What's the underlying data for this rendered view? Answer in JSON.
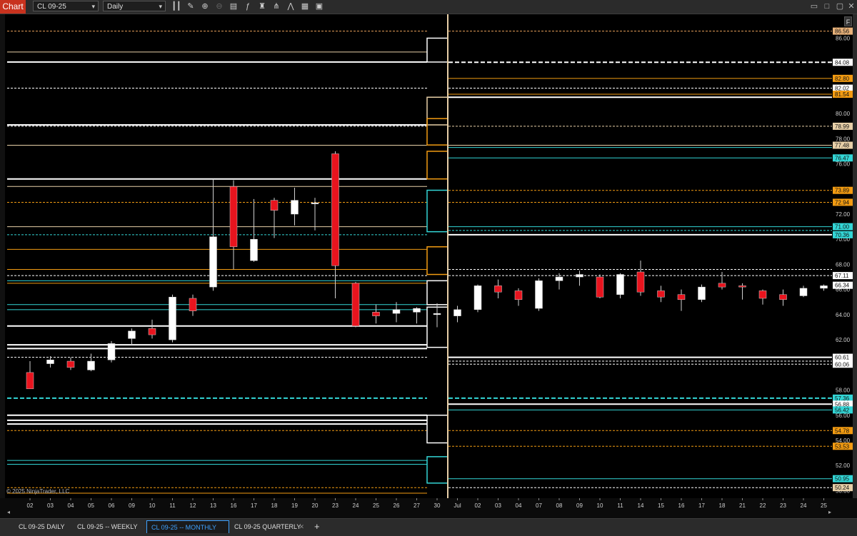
{
  "toolbar": {
    "title": "Chart",
    "instrument": "CL 09-25",
    "interval": "Daily",
    "icons": [
      "bar-type-icon",
      "draw-pencil-icon",
      "zoom-in-icon",
      "zoom-out-icon",
      "properties-icon",
      "indicators-icon",
      "strategies-icon",
      "drawing-tools-icon",
      "global-crosshair-icon",
      "data-box-icon"
    ]
  },
  "chart_data": {
    "type": "candlestick",
    "instrument": "CL 09-25",
    "interval": "Daily",
    "x_tick_labels": [
      "02",
      "03",
      "04",
      "05",
      "06",
      "09",
      "10",
      "11",
      "12",
      "13",
      "16",
      "17",
      "18",
      "19",
      "20",
      "23",
      "24",
      "25",
      "26",
      "27",
      "30",
      "Jul",
      "02",
      "03",
      "04",
      "07",
      "08",
      "09",
      "10",
      "11",
      "14",
      "15",
      "16",
      "17",
      "18",
      "21",
      "22",
      "23",
      "24",
      "25"
    ],
    "y_axis_ticks": [
      "86.00",
      "84.00",
      "82.00",
      "80.00",
      "78.00",
      "76.00",
      "74.00",
      "72.00",
      "70.00",
      "68.00",
      "66.00",
      "64.00",
      "62.00",
      "60.00",
      "58.00",
      "56.00",
      "54.00",
      "52.00",
      "50.00"
    ],
    "ylim": [
      49.4,
      87.9
    ],
    "candles": [
      {
        "x": "02",
        "o": 59.4,
        "h": 60.3,
        "l": 58.3,
        "c": 58.1
      },
      {
        "x": "03",
        "o": 60.1,
        "h": 60.7,
        "l": 59.8,
        "c": 60.4
      },
      {
        "x": "04",
        "o": 60.3,
        "h": 60.6,
        "l": 59.6,
        "c": 59.8
      },
      {
        "x": "05",
        "o": 59.6,
        "h": 60.9,
        "l": 59.5,
        "c": 60.3
      },
      {
        "x": "06",
        "o": 60.4,
        "h": 61.9,
        "l": 60.2,
        "c": 61.7
      },
      {
        "x": "09",
        "o": 62.1,
        "h": 62.9,
        "l": 61.6,
        "c": 62.7
      },
      {
        "x": "10",
        "o": 62.9,
        "h": 63.6,
        "l": 62.1,
        "c": 62.4
      },
      {
        "x": "11",
        "o": 62.0,
        "h": 65.6,
        "l": 61.8,
        "c": 65.4
      },
      {
        "x": "12",
        "o": 65.3,
        "h": 65.6,
        "l": 63.9,
        "c": 64.3
      },
      {
        "x": "13",
        "o": 66.2,
        "h": 74.8,
        "l": 65.9,
        "c": 70.2
      },
      {
        "x": "16",
        "o": 74.2,
        "h": 74.7,
        "l": 67.6,
        "c": 69.4
      },
      {
        "x": "17",
        "o": 68.3,
        "h": 73.2,
        "l": 68.2,
        "c": 70.0
      },
      {
        "x": "18",
        "o": 73.1,
        "h": 73.3,
        "l": 70.1,
        "c": 72.3
      },
      {
        "x": "19",
        "o": 72.0,
        "h": 74.1,
        "l": 71.1,
        "c": 73.1
      },
      {
        "x": "20",
        "o": 72.9,
        "h": 73.3,
        "l": 70.7,
        "c": 72.9
      },
      {
        "x": "23",
        "o": 76.8,
        "h": 77.0,
        "l": 65.3,
        "c": 67.9
      },
      {
        "x": "24",
        "o": 66.5,
        "h": 66.6,
        "l": 63.0,
        "c": 63.1
      },
      {
        "x": "25",
        "o": 64.2,
        "h": 64.8,
        "l": 63.3,
        "c": 63.9
      },
      {
        "x": "26",
        "o": 64.1,
        "h": 65.0,
        "l": 63.4,
        "c": 64.4
      },
      {
        "x": "27",
        "o": 64.2,
        "h": 64.6,
        "l": 63.3,
        "c": 64.5
      },
      {
        "x": "30",
        "o": 64.0,
        "h": 64.9,
        "l": 63.0,
        "c": 64.1
      },
      {
        "x": "Jul",
        "o": 63.9,
        "h": 64.7,
        "l": 63.4,
        "c": 64.4
      },
      {
        "x": "02",
        "o": 64.4,
        "h": 66.4,
        "l": 64.2,
        "c": 66.3
      },
      {
        "x": "03",
        "o": 66.3,
        "h": 66.8,
        "l": 65.3,
        "c": 65.8
      },
      {
        "x": "04",
        "o": 65.9,
        "h": 66.1,
        "l": 64.7,
        "c": 65.2
      },
      {
        "x": "07",
        "o": 64.5,
        "h": 66.9,
        "l": 64.3,
        "c": 66.7
      },
      {
        "x": "08",
        "o": 66.7,
        "h": 67.3,
        "l": 66.0,
        "c": 67.0
      },
      {
        "x": "09",
        "o": 67.0,
        "h": 67.5,
        "l": 66.3,
        "c": 67.2
      },
      {
        "x": "10",
        "o": 67.0,
        "h": 67.2,
        "l": 65.3,
        "c": 65.4
      },
      {
        "x": "11",
        "o": 65.6,
        "h": 67.3,
        "l": 65.3,
        "c": 67.2
      },
      {
        "x": "14",
        "o": 67.4,
        "h": 68.3,
        "l": 65.5,
        "c": 65.8
      },
      {
        "x": "15",
        "o": 65.9,
        "h": 66.3,
        "l": 65.0,
        "c": 65.4
      },
      {
        "x": "16",
        "o": 65.6,
        "h": 66.0,
        "l": 64.3,
        "c": 65.2
      },
      {
        "x": "17",
        "o": 65.2,
        "h": 66.4,
        "l": 65.0,
        "c": 66.2
      },
      {
        "x": "18",
        "o": 66.5,
        "h": 67.4,
        "l": 66.0,
        "c": 66.2
      },
      {
        "x": "21",
        "o": 66.3,
        "h": 66.5,
        "l": 65.2,
        "c": 66.2
      },
      {
        "x": "22",
        "o": 65.9,
        "h": 66.0,
        "l": 64.8,
        "c": 65.3
      },
      {
        "x": "23",
        "o": 65.6,
        "h": 66.0,
        "l": 64.7,
        "c": 65.2
      },
      {
        "x": "24",
        "o": 65.5,
        "h": 66.3,
        "l": 65.4,
        "c": 66.1
      },
      {
        "x": "25",
        "o": 66.1,
        "h": 66.4,
        "l": 65.9,
        "c": 66.3
      }
    ],
    "price_markers": [
      {
        "label": "86.56",
        "color": "#e8b27a"
      },
      {
        "label": "84.08",
        "color": "#ffffff"
      },
      {
        "label": "82.80",
        "color": "#f39c12"
      },
      {
        "label": "82.02",
        "color": "#ffffff"
      },
      {
        "label": "81.54",
        "color": "#f39c12"
      },
      {
        "label": "78.99",
        "color": "#e8d0a8"
      },
      {
        "label": "77.48",
        "color": "#e8d0a8"
      },
      {
        "label": "76.47",
        "color": "#33d6d6"
      },
      {
        "label": "73.89",
        "color": "#f39c12"
      },
      {
        "label": "72.94",
        "color": "#f39c12"
      },
      {
        "label": "71.00",
        "color": "#33d6d6"
      },
      {
        "label": "70.36",
        "color": "#33d6d6"
      },
      {
        "label": "67.11",
        "color": "#ffffff"
      },
      {
        "label": "66.34",
        "color": "#ffffff"
      },
      {
        "label": "60.61",
        "color": "#ffffff"
      },
      {
        "label": "60.06",
        "color": "#ffffff"
      },
      {
        "label": "57.36",
        "color": "#33d6d6"
      },
      {
        "label": "56.88",
        "color": "#ffffff"
      },
      {
        "label": "56.42",
        "color": "#33d6d6"
      },
      {
        "label": "54.78",
        "color": "#f39c12"
      },
      {
        "label": "53.53",
        "color": "#f39c12"
      },
      {
        "label": "50.95",
        "color": "#33d6d6"
      },
      {
        "label": "50.24",
        "color": "#e8d0a8"
      }
    ],
    "levels_left": [
      {
        "y": 86.56,
        "color": "#e8a05a",
        "style": "dashed"
      },
      {
        "y": 84.9,
        "color": "#e8d0a8",
        "style": "solid"
      },
      {
        "y": 84.1,
        "color": "#ffffff",
        "style": "solid"
      },
      {
        "y": 82.02,
        "color": "#ffffff",
        "style": "dashed"
      },
      {
        "y": 79.1,
        "color": "#ffffff",
        "style": "solid"
      },
      {
        "y": 78.99,
        "color": "#ffffff",
        "style": "dashed"
      },
      {
        "y": 77.48,
        "color": "#e8d0a8",
        "style": "solid"
      },
      {
        "y": 74.8,
        "color": "#ffffff",
        "style": "solid"
      },
      {
        "y": 74.2,
        "color": "#e8d0a8",
        "style": "solid"
      },
      {
        "y": 72.94,
        "color": "#f39c12",
        "style": "dashed"
      },
      {
        "y": 71.0,
        "color": "#e8d0a8",
        "style": "solid"
      },
      {
        "y": 70.36,
        "color": "#33d6d6",
        "style": "dashed"
      },
      {
        "y": 69.2,
        "color": "#f39c12",
        "style": "solid"
      },
      {
        "y": 67.6,
        "color": "#f39c12",
        "style": "solid"
      },
      {
        "y": 67.11,
        "color": "#ffffff",
        "style": "dashed"
      },
      {
        "y": 66.7,
        "color": "#33d6d6",
        "style": "solid"
      },
      {
        "y": 66.5,
        "color": "#f39c12",
        "style": "solid"
      },
      {
        "y": 64.8,
        "color": "#33d6d6",
        "style": "solid"
      },
      {
        "y": 64.4,
        "color": "#33d6d6",
        "style": "solid"
      },
      {
        "y": 63.1,
        "color": "#ffffff",
        "style": "solid"
      },
      {
        "y": 61.6,
        "color": "#ffffff",
        "style": "solid"
      },
      {
        "y": 61.3,
        "color": "#ffffff",
        "style": "solid"
      },
      {
        "y": 60.61,
        "color": "#ffffff",
        "style": "dashed"
      },
      {
        "y": 57.36,
        "color": "#33d6d6",
        "style": "bold-dashed"
      },
      {
        "y": 56.0,
        "color": "#ffffff",
        "style": "solid"
      },
      {
        "y": 55.6,
        "color": "#ffffff",
        "style": "solid"
      },
      {
        "y": 55.3,
        "color": "#ffffff",
        "style": "solid"
      },
      {
        "y": 54.78,
        "color": "#f39c12",
        "style": "dashed"
      },
      {
        "y": 52.4,
        "color": "#33d6d6",
        "style": "solid"
      },
      {
        "y": 52.1,
        "color": "#33d6d6",
        "style": "solid"
      },
      {
        "y": 50.24,
        "color": "#f39c12",
        "style": "dashed"
      },
      {
        "y": 49.8,
        "color": "#f39c12",
        "style": "solid"
      }
    ],
    "levels_right": [
      {
        "y": 86.56,
        "color": "#e8a05a",
        "style": "dashed"
      },
      {
        "y": 84.08,
        "color": "#ffffff",
        "style": "bold-dashed"
      },
      {
        "y": 82.8,
        "color": "#f39c12",
        "style": "solid"
      },
      {
        "y": 82.02,
        "color": "#ffffff",
        "style": "dashed"
      },
      {
        "y": 81.54,
        "color": "#f39c12",
        "style": "solid"
      },
      {
        "y": 81.3,
        "color": "#ffffff",
        "style": "solid"
      },
      {
        "y": 78.99,
        "color": "#e8d0a8",
        "style": "dashed"
      },
      {
        "y": 77.48,
        "color": "#e8d0a8",
        "style": "solid"
      },
      {
        "y": 77.3,
        "color": "#33d6d6",
        "style": "solid"
      },
      {
        "y": 76.47,
        "color": "#33d6d6",
        "style": "solid"
      },
      {
        "y": 73.89,
        "color": "#f39c12",
        "style": "dashed"
      },
      {
        "y": 72.94,
        "color": "#f39c12",
        "style": "dashed"
      },
      {
        "y": 71.0,
        "color": "#33d6d6",
        "style": "solid"
      },
      {
        "y": 70.7,
        "color": "#33d6d6",
        "style": "dashed"
      },
      {
        "y": 70.36,
        "color": "#ffffff",
        "style": "solid"
      },
      {
        "y": 67.6,
        "color": "#ffffff",
        "style": "dashed"
      },
      {
        "y": 67.11,
        "color": "#ffffff",
        "style": "dashed"
      },
      {
        "y": 60.61,
        "color": "#ffffff",
        "style": "solid"
      },
      {
        "y": 60.3,
        "color": "#ffffff",
        "style": "dashed"
      },
      {
        "y": 60.06,
        "color": "#ffffff",
        "style": "dashed"
      },
      {
        "y": 57.36,
        "color": "#33d6d6",
        "style": "bold-dashed"
      },
      {
        "y": 56.88,
        "color": "#ffffff",
        "style": "solid"
      },
      {
        "y": 56.42,
        "color": "#33d6d6",
        "style": "solid"
      },
      {
        "y": 54.78,
        "color": "#f39c12",
        "style": "dashed"
      },
      {
        "y": 53.53,
        "color": "#f39c12",
        "style": "dashed"
      },
      {
        "y": 50.95,
        "color": "#33d6d6",
        "style": "solid"
      },
      {
        "y": 50.24,
        "color": "#ffffff",
        "style": "dashed"
      }
    ]
  },
  "copyright": "© 2025 NinjaTrader, LLC",
  "panel_badge": "F",
  "bottom_tabs": [
    {
      "label": "CL 09-25 DAILY",
      "active": false
    },
    {
      "label": "CL 09-25 -- WEEKLY",
      "active": false
    },
    {
      "label": "CL 09-25 -- MONTHLY",
      "active": true
    },
    {
      "label": "CL 09-25 QUARTERLY",
      "active": false
    }
  ],
  "colors": {
    "background": "#000000",
    "up_candle": "#ffffff",
    "down_candle": "#e8141e",
    "accent_blue": "#3fa2ff",
    "title_red": "#c8321e"
  }
}
